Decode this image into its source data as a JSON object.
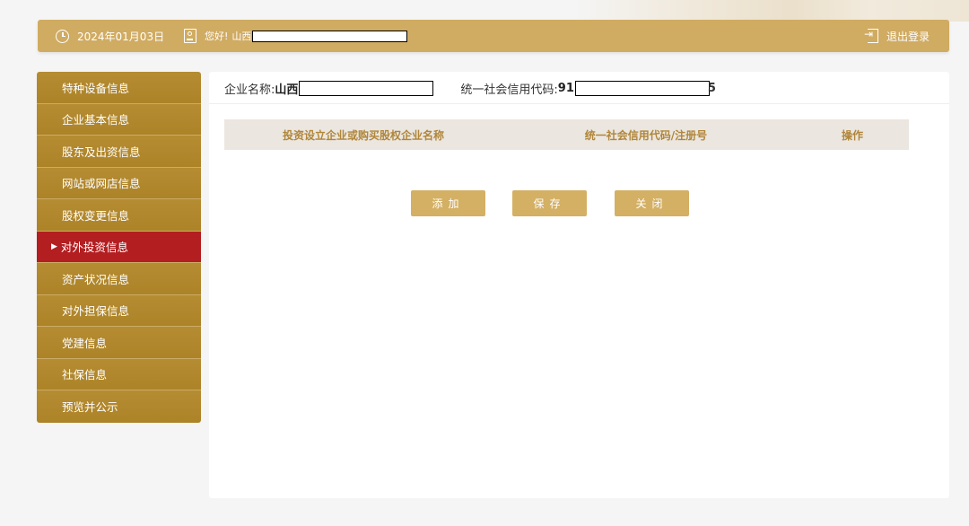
{
  "header": {
    "date": "2024年01月03日",
    "greeting": "您好!",
    "username_prefix": "山西",
    "logout_label": "退出登录"
  },
  "sidebar": {
    "items": [
      {
        "label": "特种设备信息",
        "active": false
      },
      {
        "label": "企业基本信息",
        "active": false
      },
      {
        "label": "股东及出资信息",
        "active": false
      },
      {
        "label": "网站或网店信息",
        "active": false
      },
      {
        "label": "股权变更信息",
        "active": false
      },
      {
        "label": "对外投资信息",
        "active": true
      },
      {
        "label": "资产状况信息",
        "active": false
      },
      {
        "label": "对外担保信息",
        "active": false
      },
      {
        "label": "党建信息",
        "active": false
      },
      {
        "label": "社保信息",
        "active": false
      },
      {
        "label": "预览并公示",
        "active": false
      }
    ],
    "active_marker": "▶"
  },
  "main": {
    "company_name_label": "企业名称:",
    "company_name_value": "山西",
    "credit_code_label": "统一社会信用代码:",
    "credit_code_prefix": "91",
    "credit_code_suffix": "5",
    "table": {
      "columns": [
        "投资设立企业或购买股权企业名称",
        "统一社会信用代码/注册号",
        "操作"
      ],
      "rows": []
    },
    "buttons": {
      "add": "添加",
      "save": "保存",
      "close": "关闭"
    }
  },
  "colors": {
    "topbar": "#d0ab62",
    "sidebar": "#b08629",
    "sidebar_active": "#b31e21",
    "button": "#d4b064",
    "table_header_bg": "#ebe6df",
    "table_header_text": "#b0863a"
  }
}
